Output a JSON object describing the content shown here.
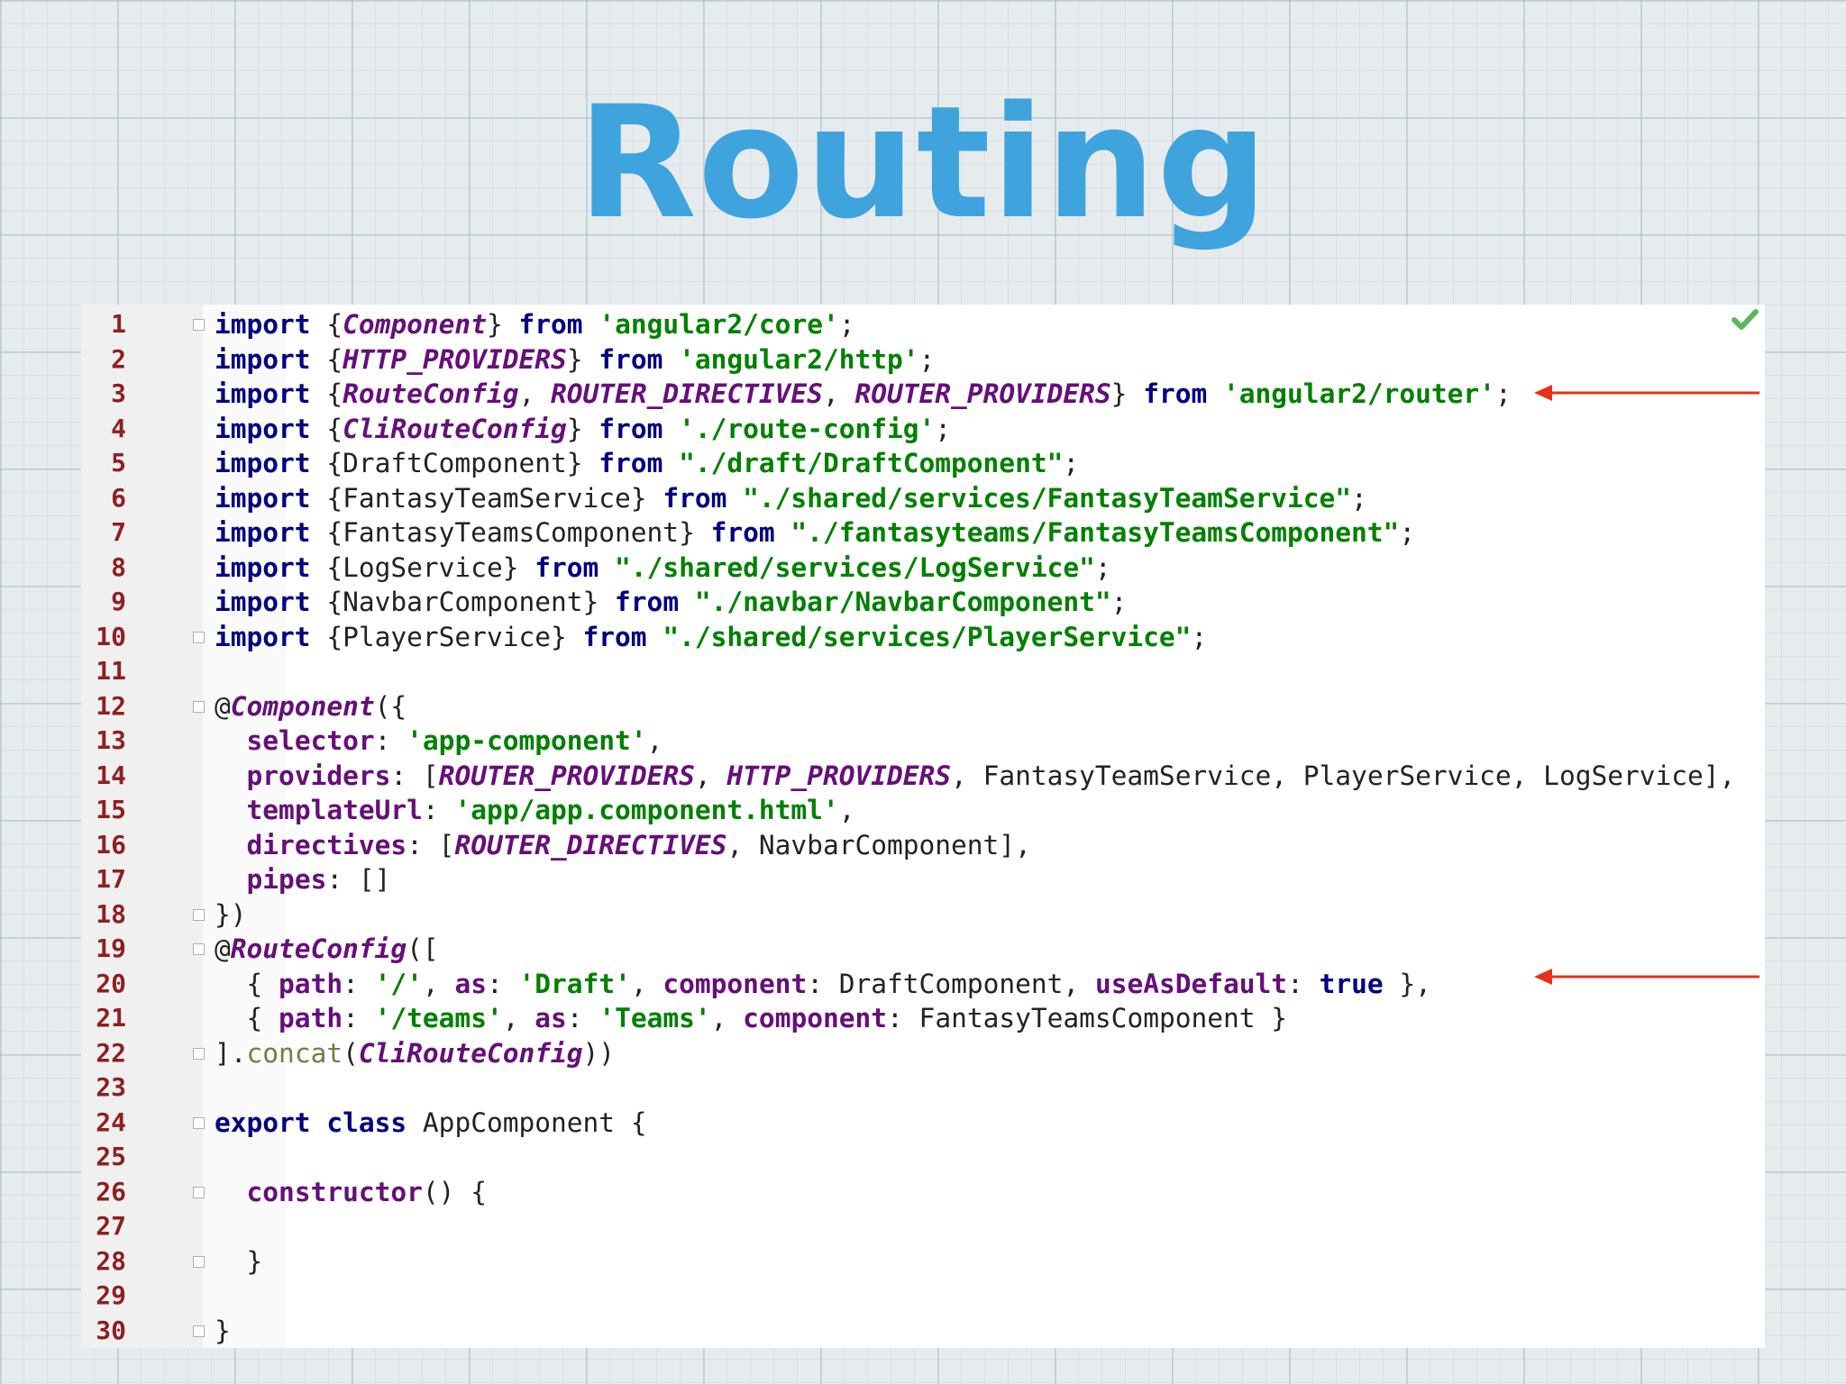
{
  "slide": {
    "title": "Routing"
  },
  "editor": {
    "line_numbers": [
      "1",
      "2",
      "3",
      "4",
      "5",
      "6",
      "7",
      "8",
      "9",
      "10",
      "11",
      "12",
      "13",
      "14",
      "15",
      "16",
      "17",
      "18",
      "19",
      "20",
      "21",
      "22",
      "23",
      "24",
      "25",
      "26",
      "27",
      "28",
      "29",
      "30"
    ],
    "lines": [
      [
        {
          "t": "import",
          "c": "kw"
        },
        {
          "t": " {",
          "c": "plain"
        },
        {
          "t": "Component",
          "c": "it"
        },
        {
          "t": "} ",
          "c": "plain"
        },
        {
          "t": "from",
          "c": "kw"
        },
        {
          "t": " ",
          "c": "plain"
        },
        {
          "t": "'angular2/core'",
          "c": "str"
        },
        {
          "t": ";",
          "c": "plain"
        }
      ],
      [
        {
          "t": "import",
          "c": "kw"
        },
        {
          "t": " {",
          "c": "plain"
        },
        {
          "t": "HTTP_PROVIDERS",
          "c": "it"
        },
        {
          "t": "} ",
          "c": "plain"
        },
        {
          "t": "from",
          "c": "kw"
        },
        {
          "t": " ",
          "c": "plain"
        },
        {
          "t": "'angular2/http'",
          "c": "str"
        },
        {
          "t": ";",
          "c": "plain"
        }
      ],
      [
        {
          "t": "import",
          "c": "kw"
        },
        {
          "t": " {",
          "c": "plain"
        },
        {
          "t": "RouteConfig",
          "c": "it"
        },
        {
          "t": ", ",
          "c": "plain"
        },
        {
          "t": "ROUTER_DIRECTIVES",
          "c": "it"
        },
        {
          "t": ", ",
          "c": "plain"
        },
        {
          "t": "ROUTER_PROVIDERS",
          "c": "it"
        },
        {
          "t": "} ",
          "c": "plain"
        },
        {
          "t": "from",
          "c": "kw"
        },
        {
          "t": " ",
          "c": "plain"
        },
        {
          "t": "'angular2/router'",
          "c": "str"
        },
        {
          "t": ";",
          "c": "plain"
        }
      ],
      [
        {
          "t": "import",
          "c": "kw"
        },
        {
          "t": " {",
          "c": "plain"
        },
        {
          "t": "CliRouteConfig",
          "c": "it"
        },
        {
          "t": "} ",
          "c": "plain"
        },
        {
          "t": "from",
          "c": "kw"
        },
        {
          "t": " ",
          "c": "plain"
        },
        {
          "t": "'./route-config'",
          "c": "str"
        },
        {
          "t": ";",
          "c": "plain"
        }
      ],
      [
        {
          "t": "import",
          "c": "kw"
        },
        {
          "t": " {DraftComponent} ",
          "c": "plain"
        },
        {
          "t": "from",
          "c": "kw"
        },
        {
          "t": " ",
          "c": "plain"
        },
        {
          "t": "\"./draft/DraftComponent\"",
          "c": "str"
        },
        {
          "t": ";",
          "c": "plain"
        }
      ],
      [
        {
          "t": "import",
          "c": "kw"
        },
        {
          "t": " {FantasyTeamService} ",
          "c": "plain"
        },
        {
          "t": "from",
          "c": "kw"
        },
        {
          "t": " ",
          "c": "plain"
        },
        {
          "t": "\"./shared/services/FantasyTeamService\"",
          "c": "str"
        },
        {
          "t": ";",
          "c": "plain"
        }
      ],
      [
        {
          "t": "import",
          "c": "kw"
        },
        {
          "t": " {FantasyTeamsComponent} ",
          "c": "plain"
        },
        {
          "t": "from",
          "c": "kw"
        },
        {
          "t": " ",
          "c": "plain"
        },
        {
          "t": "\"./fantasyteams/FantasyTeamsComponent\"",
          "c": "str"
        },
        {
          "t": ";",
          "c": "plain"
        }
      ],
      [
        {
          "t": "import",
          "c": "kw"
        },
        {
          "t": " {LogService} ",
          "c": "plain"
        },
        {
          "t": "from",
          "c": "kw"
        },
        {
          "t": " ",
          "c": "plain"
        },
        {
          "t": "\"./shared/services/LogService\"",
          "c": "str"
        },
        {
          "t": ";",
          "c": "plain"
        }
      ],
      [
        {
          "t": "import",
          "c": "kw"
        },
        {
          "t": " {NavbarComponent} ",
          "c": "plain"
        },
        {
          "t": "from",
          "c": "kw"
        },
        {
          "t": " ",
          "c": "plain"
        },
        {
          "t": "\"./navbar/NavbarComponent\"",
          "c": "str"
        },
        {
          "t": ";",
          "c": "plain"
        }
      ],
      [
        {
          "t": "import",
          "c": "kw"
        },
        {
          "t": " {PlayerService} ",
          "c": "plain"
        },
        {
          "t": "from",
          "c": "kw"
        },
        {
          "t": " ",
          "c": "plain"
        },
        {
          "t": "\"./shared/services/PlayerService\"",
          "c": "str"
        },
        {
          "t": ";",
          "c": "plain"
        }
      ],
      [],
      [
        {
          "t": "@",
          "c": "plain"
        },
        {
          "t": "Component",
          "c": "it"
        },
        {
          "t": "({",
          "c": "plain"
        }
      ],
      [
        {
          "t": "  ",
          "c": "plain"
        },
        {
          "t": "selector",
          "c": "prop"
        },
        {
          "t": ": ",
          "c": "plain"
        },
        {
          "t": "'app-component'",
          "c": "str"
        },
        {
          "t": ",",
          "c": "plain"
        }
      ],
      [
        {
          "t": "  ",
          "c": "plain"
        },
        {
          "t": "providers",
          "c": "prop"
        },
        {
          "t": ": [",
          "c": "plain"
        },
        {
          "t": "ROUTER_PROVIDERS",
          "c": "it"
        },
        {
          "t": ", ",
          "c": "plain"
        },
        {
          "t": "HTTP_PROVIDERS",
          "c": "it"
        },
        {
          "t": ", FantasyTeamService, PlayerService, LogService],",
          "c": "plain"
        }
      ],
      [
        {
          "t": "  ",
          "c": "plain"
        },
        {
          "t": "templateUrl",
          "c": "prop"
        },
        {
          "t": ": ",
          "c": "plain"
        },
        {
          "t": "'app/app.component.html'",
          "c": "str"
        },
        {
          "t": ",",
          "c": "plain"
        }
      ],
      [
        {
          "t": "  ",
          "c": "plain"
        },
        {
          "t": "directives",
          "c": "prop"
        },
        {
          "t": ": [",
          "c": "plain"
        },
        {
          "t": "ROUTER_DIRECTIVES",
          "c": "it"
        },
        {
          "t": ", NavbarComponent],",
          "c": "plain"
        }
      ],
      [
        {
          "t": "  ",
          "c": "plain"
        },
        {
          "t": "pipes",
          "c": "prop"
        },
        {
          "t": ": []",
          "c": "plain"
        }
      ],
      [
        {
          "t": "})",
          "c": "plain"
        }
      ],
      [
        {
          "t": "@",
          "c": "plain"
        },
        {
          "t": "RouteConfig",
          "c": "it"
        },
        {
          "t": "([",
          "c": "plain"
        }
      ],
      [
        {
          "t": "  { ",
          "c": "plain"
        },
        {
          "t": "path",
          "c": "prop"
        },
        {
          "t": ": ",
          "c": "plain"
        },
        {
          "t": "'/'",
          "c": "str"
        },
        {
          "t": ", ",
          "c": "plain"
        },
        {
          "t": "as",
          "c": "prop"
        },
        {
          "t": ": ",
          "c": "plain"
        },
        {
          "t": "'Draft'",
          "c": "str"
        },
        {
          "t": ", ",
          "c": "plain"
        },
        {
          "t": "component",
          "c": "prop"
        },
        {
          "t": ": DraftComponent, ",
          "c": "plain"
        },
        {
          "t": "useAsDefault",
          "c": "prop"
        },
        {
          "t": ": ",
          "c": "plain"
        },
        {
          "t": "true",
          "c": "kw"
        },
        {
          "t": " },",
          "c": "plain"
        }
      ],
      [
        {
          "t": "  { ",
          "c": "plain"
        },
        {
          "t": "path",
          "c": "prop"
        },
        {
          "t": ": ",
          "c": "plain"
        },
        {
          "t": "'/teams'",
          "c": "str"
        },
        {
          "t": ", ",
          "c": "plain"
        },
        {
          "t": "as",
          "c": "prop"
        },
        {
          "t": ": ",
          "c": "plain"
        },
        {
          "t": "'Teams'",
          "c": "str"
        },
        {
          "t": ", ",
          "c": "plain"
        },
        {
          "t": "component",
          "c": "prop"
        },
        {
          "t": ": FantasyTeamsComponent }",
          "c": "plain"
        }
      ],
      [
        {
          "t": "].",
          "c": "plain"
        },
        {
          "t": "concat",
          "c": "fn"
        },
        {
          "t": "(",
          "c": "plain"
        },
        {
          "t": "CliRouteConfig",
          "c": "it"
        },
        {
          "t": "))",
          "c": "plain"
        }
      ],
      [],
      [
        {
          "t": "export",
          "c": "kw"
        },
        {
          "t": " ",
          "c": "plain"
        },
        {
          "t": "class",
          "c": "kw"
        },
        {
          "t": " AppComponent {",
          "c": "plain"
        }
      ],
      [],
      [
        {
          "t": "  ",
          "c": "plain"
        },
        {
          "t": "constructor",
          "c": "prop"
        },
        {
          "t": "() {",
          "c": "plain"
        }
      ],
      [],
      [
        {
          "t": "  }",
          "c": "plain"
        }
      ],
      [],
      [
        {
          "t": "}",
          "c": "plain"
        }
      ]
    ],
    "fold_lines": [
      1,
      10,
      12,
      18,
      19,
      22,
      24,
      26,
      28,
      30
    ],
    "annotation_arrow_lines": [
      3,
      20
    ],
    "colors": {
      "keyword": "#000080",
      "string": "#008000",
      "identifier_italic": "#660e7a",
      "line_number": "#8f1f22",
      "title": "#3fa3dd",
      "arrow": "#e8311a",
      "check": "#5cb85c"
    },
    "icons": {
      "status": "check-icon",
      "annotation": "arrow-left-icon"
    }
  }
}
